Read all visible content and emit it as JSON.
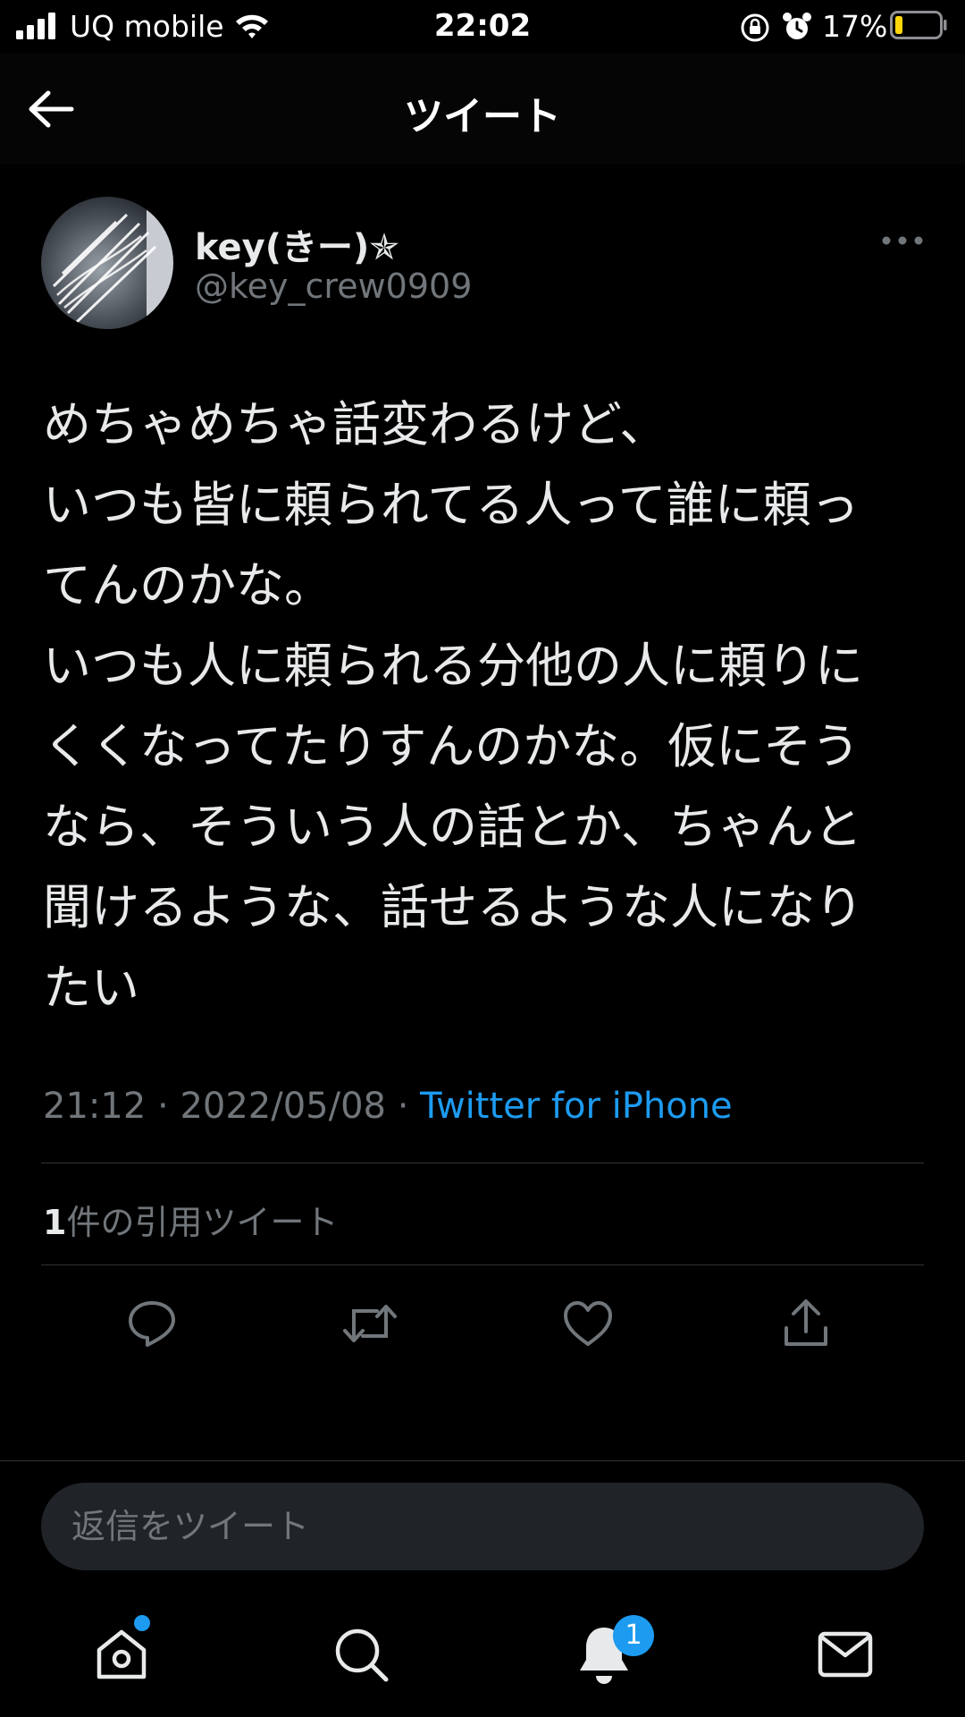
{
  "status_bar": {
    "carrier": "UQ mobile",
    "time": "22:02",
    "battery_percent": "17%"
  },
  "header": {
    "title": "ツイート",
    "back_icon": "arrow-left-icon"
  },
  "tweet": {
    "author_name": "key(きー)✯",
    "author_handle": "@key_crew0909",
    "text": "めちゃめちゃ話変わるけど、\nいつも皆に頼られてる人って誰に頼ってんのかな。\nいつも人に頼られる分他の人に頼りにくくなってたりすんのかな。仮にそうなら、そういう人の話とか、ちゃんと聞けるような、話せるような人になりたい",
    "time": "21:12",
    "date": "2022/05/08",
    "separator": " · ",
    "source": "Twitter for iPhone",
    "quote_count": "1",
    "quote_label": "件の引用ツイート"
  },
  "actions": [
    "reply-icon",
    "retweet-icon",
    "like-icon",
    "share-icon"
  ],
  "reply": {
    "placeholder": "返信をツイート"
  },
  "tab_bar": {
    "tabs": [
      "home-icon",
      "search-icon",
      "notifications-icon",
      "messages-icon"
    ],
    "notification_badge": "1"
  },
  "colors": {
    "accent": "#1d9bf0",
    "background": "#000000",
    "secondary_text": "#71767b"
  }
}
